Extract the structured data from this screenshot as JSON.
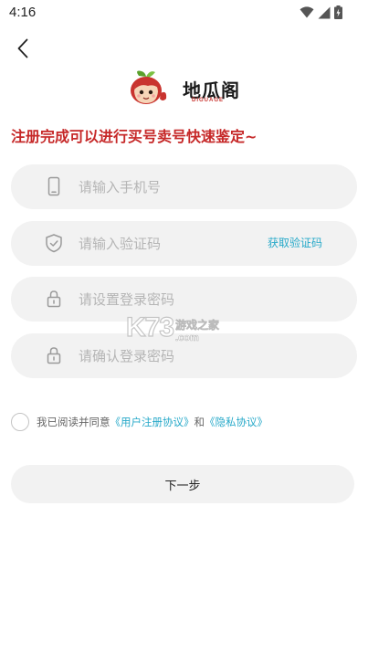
{
  "status_bar": {
    "time": "4:16",
    "icons": [
      "wifi-icon",
      "signal-icon",
      "battery-icon"
    ]
  },
  "header": {
    "back_icon": "chevron-left-icon"
  },
  "logo": {
    "name": "地瓜阁",
    "subtitle": "DIGUAGE"
  },
  "headline": "注册完成可以进行买号卖号快速鉴定~",
  "form": {
    "phone": {
      "placeholder": "请输入手机号",
      "icon": "phone-icon",
      "value": ""
    },
    "code": {
      "placeholder": "请输入验证码",
      "icon": "shield-icon",
      "value": "",
      "get_code_label": "获取验证码"
    },
    "password": {
      "placeholder": "请设置登录密码",
      "icon": "lock-icon",
      "value": ""
    },
    "confirm_password": {
      "placeholder": "请确认登录密码",
      "icon": "lock-icon",
      "value": ""
    }
  },
  "agreement": {
    "checked": false,
    "prefix": "我已阅读并同意",
    "user_agreement": "《用户注册协议》",
    "conjunction": "和",
    "privacy_agreement": "《隐私协议》"
  },
  "next_button": "下一步",
  "watermark": {
    "brand": "K73",
    "cn": "游戏之家",
    "domain": ".com"
  },
  "colors": {
    "headline": "#c62828",
    "link": "#27a9c9",
    "field_bg": "#f2f2f2"
  }
}
